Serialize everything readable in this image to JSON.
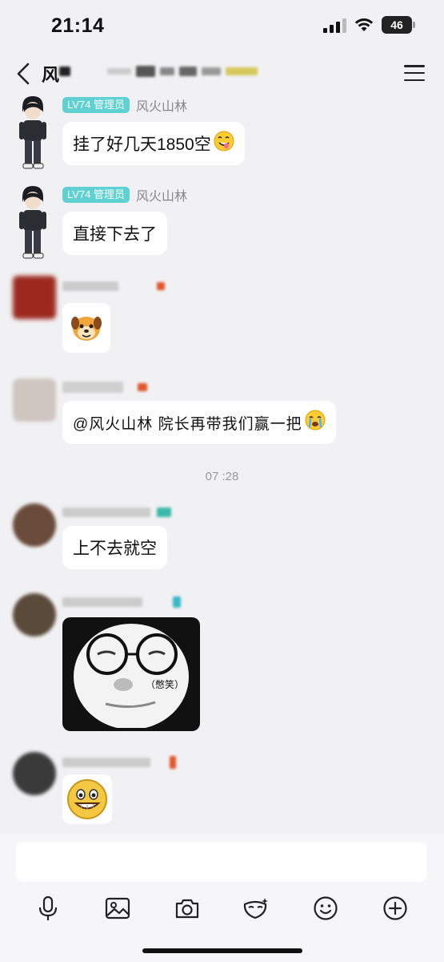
{
  "status_bar": {
    "time": "21:14",
    "battery": "46",
    "icons": [
      "signal-icon",
      "wifi-icon",
      "battery-icon"
    ]
  },
  "nav": {
    "back_icon": "chevron-left-icon",
    "title": "风",
    "menu_icon": "hamburger-menu-icon"
  },
  "messages": [
    {
      "sender_badge": "LV74 管理员",
      "sender_name": "风火山林",
      "text": "挂了好几天1850空",
      "emoji": "face-with-tongue-emoji"
    },
    {
      "sender_badge": "LV74 管理员",
      "sender_name": "风火山林",
      "text": "直接下去了"
    },
    {
      "sender_name": "",
      "sticker": "dog-face-sticker"
    },
    {
      "sender_name": "",
      "text": "@风火山林  院长再带我们赢一把",
      "emoji": "crying-face-emoji"
    },
    {
      "timestamp": "07 :28"
    },
    {
      "sender_name": "",
      "text": "上不去就空"
    },
    {
      "sender_name": "",
      "sticker_caption": "（憋笑）",
      "sticker": "round-glasses-meme-sticker"
    },
    {
      "sender_name": "",
      "sticker": "grinning-face-sticker"
    }
  ],
  "input": {
    "placeholder": ""
  },
  "toolbar": {
    "icons": [
      "microphone-icon",
      "image-icon",
      "camera-icon",
      "mask-icon",
      "smiley-icon",
      "plus-circle-icon"
    ]
  },
  "colors": {
    "background": "#f1f1f3",
    "bubble": "#ffffff",
    "badge": "#5fd1d3",
    "sender_name": "#888888"
  }
}
